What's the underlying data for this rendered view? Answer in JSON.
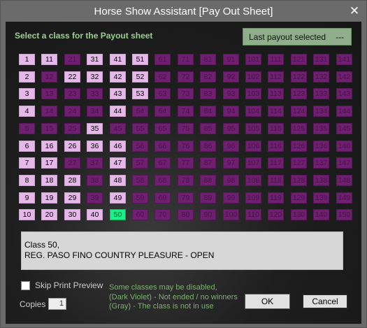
{
  "window": {
    "title": "Horse Show Assistant  [Pay Out Sheet]",
    "close_glyph": "✕"
  },
  "header": {
    "label": "Select a class for the Payout sheet"
  },
  "last_payout": {
    "label": "Last payout selected",
    "value": "---"
  },
  "grid": {
    "enabled": [
      1,
      2,
      3,
      4,
      6,
      7,
      8,
      9,
      10,
      11,
      16,
      17,
      18,
      19,
      20,
      22,
      26,
      28,
      29,
      30,
      31,
      32,
      35,
      36,
      40,
      41,
      42,
      43,
      44,
      46,
      47,
      48,
      49,
      51,
      52,
      53
    ],
    "selected": 50
  },
  "info": {
    "line1": "Class 50,",
    "line2": "REG. PASO FINO COUNTRY PLEASURE - OPEN"
  },
  "options": {
    "skip_print_preview": "Skip Print Preview",
    "copies_label": "Copies",
    "copies_value": "1"
  },
  "legend": {
    "line1": "Some classes may be disabled,",
    "line2": "(Dark Violet) - Not ended / no winners",
    "line3": "(Gray) - The class is not in use"
  },
  "buttons": {
    "ok": "OK",
    "cancel": "Cancel"
  }
}
